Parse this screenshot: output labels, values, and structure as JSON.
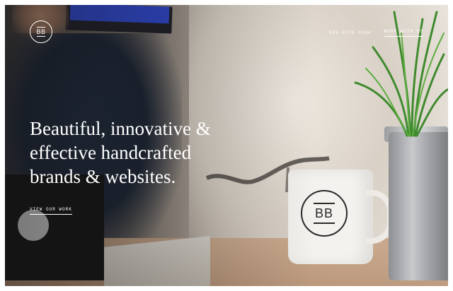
{
  "brand": {
    "logo_text": "BB"
  },
  "nav": {
    "phone": "023 8178 0164",
    "work_with_us": "WORK WITH US"
  },
  "hero": {
    "title_lines": [
      "Beautiful, innovative &",
      "effective handcrafted",
      "brands & websites."
    ],
    "cta": "VIEW OUR WORK"
  },
  "mug": {
    "logo_text": "BB"
  }
}
